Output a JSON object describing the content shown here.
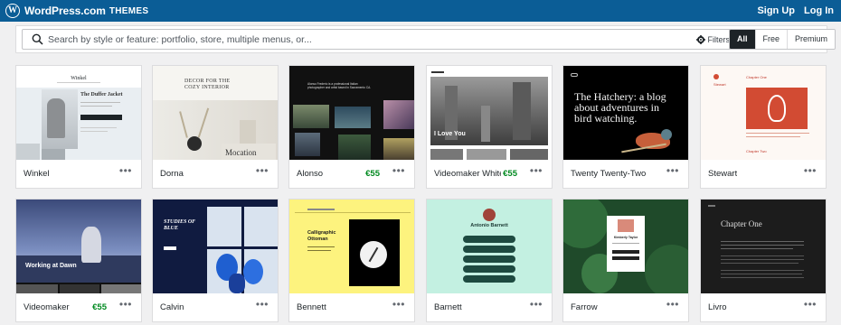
{
  "header": {
    "brand": "WordPress.com",
    "section": "THEMES",
    "signup": "Sign Up",
    "login": "Log In"
  },
  "search": {
    "placeholder": "Search by style or feature: portfolio, store, multiple menus, or...",
    "filters_label": "Filters"
  },
  "tabs": [
    {
      "label": "All",
      "active": true
    },
    {
      "label": "Free"
    },
    {
      "label": "Premium"
    }
  ],
  "themes": [
    {
      "name": "Winkel",
      "price": "",
      "preview": {
        "title": "Winkel",
        "heading": "The Duffer Jacket"
      }
    },
    {
      "name": "Dorna",
      "price": "",
      "preview": {
        "heading_line1": "DECOR FOR THE",
        "heading_line2": "COZY INTERIOR",
        "caption": "Mocation"
      }
    },
    {
      "name": "Alonso",
      "price": "€55",
      "preview": {
        "intro": "Alonso Frederic is a professional Italian photographer and artist based in Sacramento CA."
      }
    },
    {
      "name": "Videomaker White",
      "price": "€55",
      "preview": {
        "caption": "I Love You"
      }
    },
    {
      "name": "Twenty Twenty-Two",
      "price": "",
      "preview": {
        "heading": "The Hatchery: a blog about adventures in bird watching."
      }
    },
    {
      "name": "Stewart",
      "price": "",
      "preview": {
        "title": "Stewart",
        "chapter": "Chapter One",
        "chapter2": "Chapter Two"
      }
    },
    {
      "name": "Videomaker",
      "price": "€55",
      "preview": {
        "caption": "Working at Dawn"
      }
    },
    {
      "name": "Calvin",
      "price": "",
      "preview": {
        "heading": "STUDIES OF BLUE"
      }
    },
    {
      "name": "Bennett",
      "price": "",
      "preview": {
        "heading": "Calligraphic Ottoman"
      }
    },
    {
      "name": "Barnett",
      "price": "",
      "preview": {
        "heading": "Antonio Barnett"
      }
    },
    {
      "name": "Farrow",
      "price": "",
      "preview": {
        "heading": "Kimberly Taylor"
      }
    },
    {
      "name": "Livro",
      "price": "",
      "preview": {
        "heading": "Chapter One"
      }
    }
  ],
  "card_menu": "•••",
  "colors": {
    "topbar": "#0b5d96",
    "price_green": "#008a20",
    "tab_active": "#1d2327"
  }
}
